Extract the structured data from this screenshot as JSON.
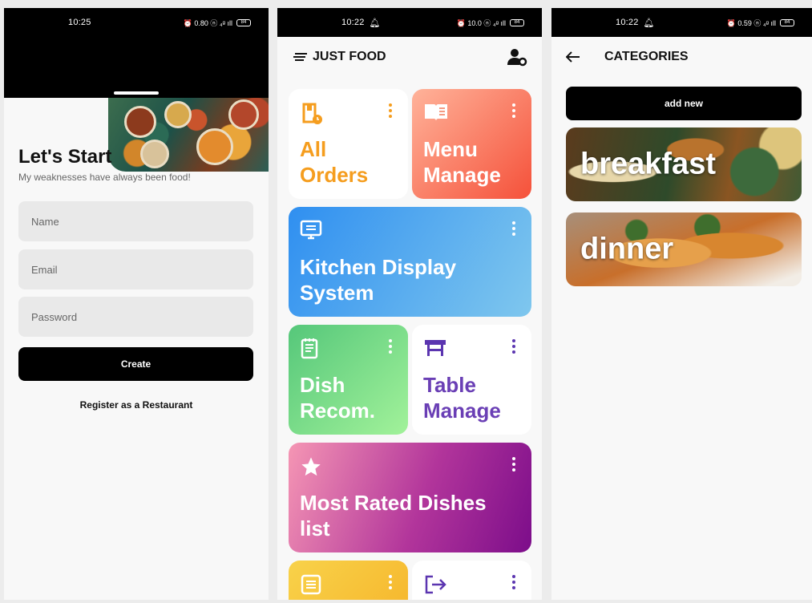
{
  "phone1": {
    "status": {
      "time": "10:25",
      "icons": "⏰ 0.80 ⓝ ₄ᵍ ıll",
      "battery": "84"
    },
    "title": "Let's Start",
    "subtitle": "My weaknesses have always been food!",
    "name_placeholder": "Name",
    "email_placeholder": "Email",
    "password_placeholder": "Password",
    "create_label": "Create",
    "register_label": "Register as a Restaurant"
  },
  "phone2": {
    "status": {
      "time": "10:22",
      "icons": "⏰ 10.0 ⓝ ₄ᵍ ıll",
      "battery": "84"
    },
    "app_title": "JUST FOOD",
    "cards": [
      {
        "line1": "All",
        "line2": "Orders",
        "color": "#f59d1e"
      },
      {
        "line1": "Menu",
        "line2": "Manage",
        "color": "#ffffff"
      },
      {
        "line1": "Kitchen Display",
        "line2": "System",
        "color": "#ffffff"
      },
      {
        "line1": "Dish",
        "line2": "Recom.",
        "color": "#ffffff"
      },
      {
        "line1": "Table",
        "line2": "Manage",
        "color": "#6a3fb5"
      },
      {
        "line1": "Most Rated Dishes",
        "line2": "list",
        "color": "#ffffff"
      }
    ]
  },
  "phone3": {
    "status": {
      "time": "10:22",
      "icons": "⏰ 0.59 ⓝ ₄ᵍ ıll",
      "battery": "84"
    },
    "title": "CATEGORIES",
    "add_label": "add new",
    "categories": [
      "breakfast",
      "dinner"
    ]
  },
  "icons": [
    "back-arrow-icon",
    "menu-lines-icon",
    "user-gear-icon",
    "bookmark-clock-icon",
    "book-open-icon",
    "monitor-icon",
    "notepad-icon",
    "table-icon",
    "star-icon",
    "list-icon",
    "logout-icon",
    "more-vert-icon",
    "alarm-icon",
    "bell-icon"
  ]
}
